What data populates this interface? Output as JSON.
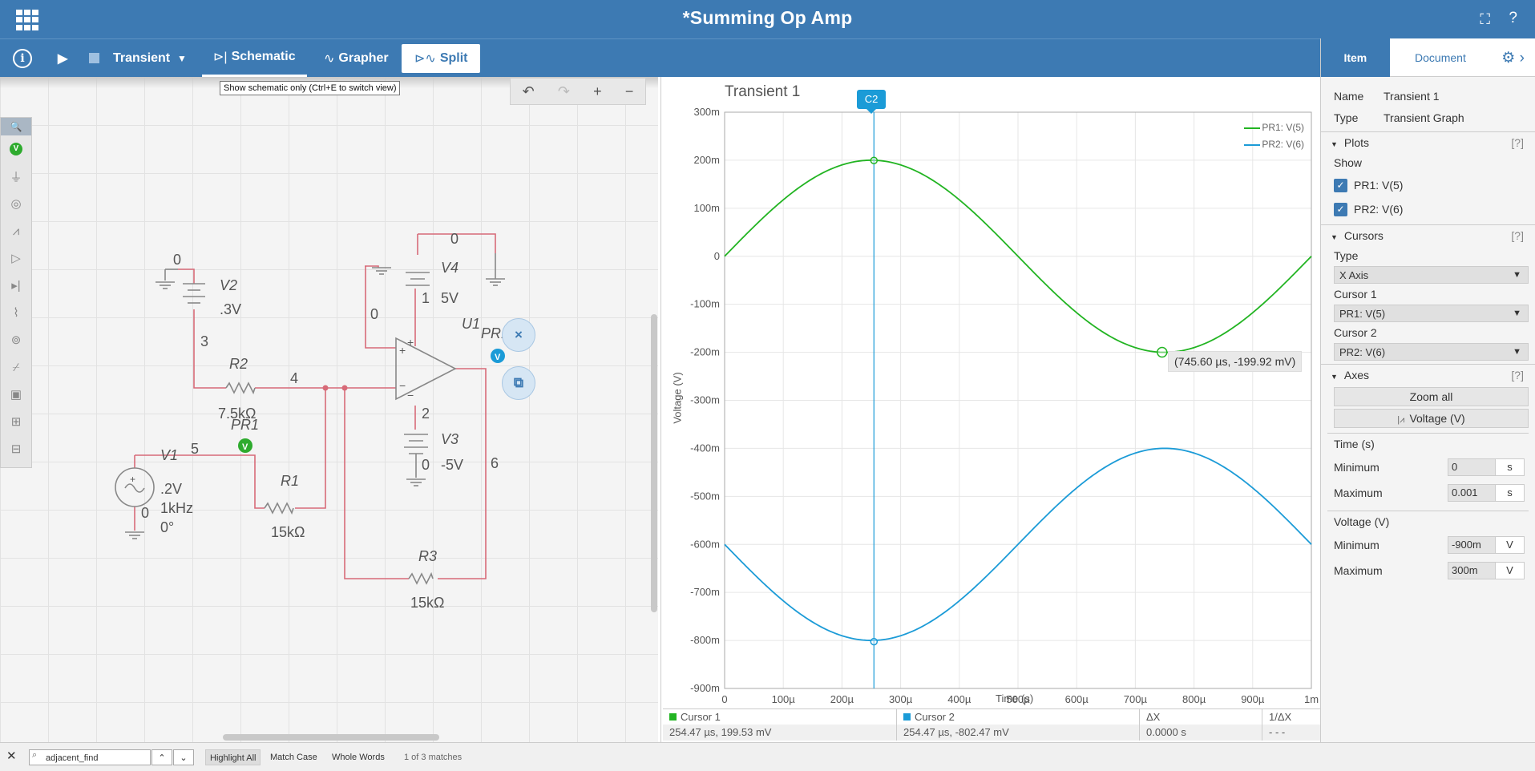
{
  "app": {
    "title": "*Summing Op Amp"
  },
  "toolbar": {
    "analysis": "Transient",
    "tab_schematic": "Schematic",
    "tab_grapher": "Grapher",
    "tab_split": "Split",
    "tooltip": "Show schematic only (Ctrl+E to switch view)"
  },
  "schematic": {
    "labels": {
      "v2_name": "V2",
      "v2_value": ".3V",
      "v2_gnd": "0",
      "v4_name": "V4",
      "v4_value": "5V",
      "v4_gnd": "0",
      "u1_name": "U1",
      "u1_ref": "0",
      "pr_label": "PR1",
      "r2_name": "R2",
      "r2_value": "7.5kΩ",
      "pr1_name": "PR1",
      "v1_name": "V1",
      "v1_amp": ".2V",
      "v1_freq": "1kHz",
      "v1_phase": "0°",
      "v1_gnd": "0",
      "r1_name": "R1",
      "r1_value": "15kΩ",
      "v3_name": "V3",
      "v3_value": "-5V",
      "v3_gnd": "0",
      "r3_name": "R3",
      "r3_value": "15kΩ",
      "node1": "1",
      "node2": "2",
      "node3": "3",
      "node4": "4",
      "node5": "5",
      "node6": "6"
    },
    "probe_symbol": "V",
    "float_delete": "×",
    "float_copy": "⧉"
  },
  "grapher": {
    "title": "Transient 1",
    "cursor_tag": "C2",
    "readout": "(745.60 µs, -199.92 mV)",
    "legend": [
      {
        "name": "PR1: V(5)",
        "color": "#22b422"
      },
      {
        "name": "PR2: V(6)",
        "color": "#1b9bd7"
      }
    ],
    "cursor_table": {
      "headers": [
        "Cursor 1",
        "Cursor 2",
        "ΔX",
        "1/ΔX"
      ],
      "values": [
        "254.47 µs, 199.53 mV",
        "254.47 µs, -802.47 mV",
        "0.0000 s",
        "- - -"
      ]
    }
  },
  "chart_data": {
    "type": "line",
    "title": "Transient 1",
    "xlabel": "Time (s)",
    "ylabel": "Voltage (V)",
    "xlim": [
      0,
      0.001
    ],
    "ylim": [
      -0.9,
      0.3
    ],
    "grid": true,
    "legend": "top-right",
    "x_ticks": [
      "0",
      "100µ",
      "200µ",
      "300µ",
      "400µ",
      "500µ",
      "600µ",
      "700µ",
      "800µ",
      "900µ",
      "1m"
    ],
    "y_ticks": [
      "300m",
      "200m",
      "100m",
      "0",
      "-100m",
      "-200m",
      "-300m",
      "-400m",
      "-500m",
      "-600m",
      "-700m",
      "-800m",
      "-900m"
    ],
    "series": [
      {
        "name": "PR1: V(5)",
        "color": "#22b422",
        "offset": 0,
        "amplitude": 0.2,
        "frequency_hz": 1000,
        "phase_deg": 0
      },
      {
        "name": "PR2: V(6)",
        "color": "#1b9bd7",
        "offset": -0.6,
        "amplitude": 0.2,
        "frequency_hz": 1000,
        "phase_deg": 180
      }
    ],
    "cursors": [
      {
        "name": "C2",
        "x": 0.00025447
      }
    ],
    "markers": [
      {
        "x": 0.0002545,
        "y": 0.1995
      },
      {
        "x": 0.0002545,
        "y": -0.8025
      },
      {
        "x": 0.0007456,
        "y": -0.1999
      }
    ]
  },
  "sidebar": {
    "tab_item": "Item",
    "tab_document": "Document",
    "name_label": "Name",
    "name_value": "Transient 1",
    "type_label": "Type",
    "type_value": "Transient Graph",
    "plots_title": "Plots",
    "help": "[?]",
    "show_label": "Show",
    "plot1": "PR1: V(5)",
    "plot2": "PR2: V(6)",
    "cursors_title": "Cursors",
    "cursor_type_label": "Type",
    "cursor_type_value": "X Axis",
    "cursor1_label": "Cursor 1",
    "cursor1_value": "PR1: V(5)",
    "cursor2_label": "Cursor 2",
    "cursor2_value": "PR2: V(6)",
    "axes_title": "Axes",
    "zoom_all": "Zoom all",
    "voltage_btn": "Voltage (V)",
    "time_label": "Time (s)",
    "time_min_label": "Minimum",
    "time_min": "0",
    "time_max_label": "Maximum",
    "time_max": "0.001",
    "time_unit": "s",
    "volt_label": "Voltage (V)",
    "volt_min_label": "Minimum",
    "volt_min": "-900m",
    "volt_max_label": "Maximum",
    "volt_max": "300m",
    "volt_unit": "V"
  },
  "findbar": {
    "query": "adjacent_find",
    "highlight_all": "Highlight All",
    "match_case": "Match Case",
    "whole_words": "Whole Words",
    "count": "1 of 3 matches"
  }
}
